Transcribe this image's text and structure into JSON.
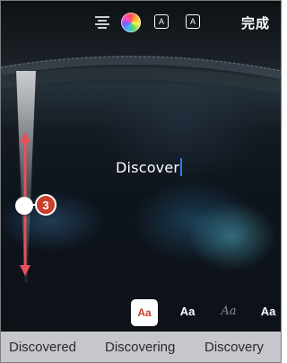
{
  "toolbar": {
    "align_icon": "align-center-icon",
    "color_icon": "color-wheel-icon",
    "effect_a_label": "A",
    "effect_b_label": "A",
    "done_label": "完成"
  },
  "editor": {
    "typed_text": "Discover"
  },
  "size_slider": {
    "callout_number": "3",
    "value": 0.5
  },
  "font_styles": [
    {
      "label": "Aa",
      "selected": true
    },
    {
      "label": "Aa",
      "selected": false
    },
    {
      "label": "Aa",
      "selected": false
    },
    {
      "label": "Aa",
      "selected": false
    }
  ],
  "suggestions": [
    "Discovered",
    "Discovering",
    "Discovery"
  ],
  "colors": {
    "accent": "#c8402c",
    "caret": "#2f7cf6",
    "suggestion_bar": "#c5c7cc"
  }
}
